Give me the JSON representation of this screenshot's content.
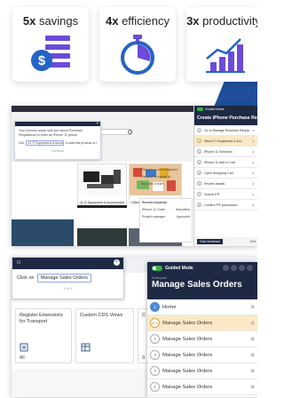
{
  "stats": [
    {
      "value": "5x",
      "label": "savings",
      "icon": "dollar-list-icon"
    },
    {
      "value": "4x",
      "label": "efficiency",
      "icon": "stopwatch-icon"
    },
    {
      "value": "3x",
      "label": "productivity",
      "icon": "bar-chart-trend-icon"
    }
  ],
  "shot1": {
    "popup": {
      "line1": "Your Director spoke with you about Purchase Requisitions to order an iPhone 11 phone.",
      "line2": "Click",
      "chip1": "11 IT Equipment & Accessories",
      "line3": "to add this product to the cart.",
      "next": "Continue"
    },
    "panel": {
      "brand": "Guided Mode",
      "title": "Create iPhone Purchase Req",
      "steps": [
        {
          "n": "1",
          "text": "Go to Manage Purchase Requisitions"
        },
        {
          "n": "2",
          "text": "Select IT Equipment & Acc"
        },
        {
          "n": "3",
          "text": "iPhone 11 Selection"
        },
        {
          "n": "4",
          "text": "iPhone 11 Add to Cart"
        },
        {
          "n": "5",
          "text": "Open Shopping Cart"
        },
        {
          "n": "6",
          "text": "Review details"
        },
        {
          "n": "7",
          "text": "Submit PR"
        },
        {
          "n": "8",
          "text": "Confirm PR submission"
        }
      ],
      "footer_button": "Give feedback",
      "footer_right": "Exit"
    },
    "tiles": [
      {
        "label": "11 IT Equipment & Accessories"
      },
      {
        "label": "Office Supplies"
      }
    ],
    "links": [
      "Request a consulting item",
      "Request on behalf of",
      "Buy with a team"
    ],
    "requests": {
      "title": "Recent requests",
      "items": [
        {
          "name": "iPhone 11 Order",
          "status": "Submitted"
        },
        {
          "name": "Project manager",
          "status": "Approved"
        }
      ]
    }
  },
  "shot2": {
    "popup": {
      "label": "Click on",
      "chip": "Manage Sales Orders",
      "pager": "1 of 8"
    },
    "tiles": [
      {
        "title": "Register Extensions for Transport",
        "footer": "All"
      },
      {
        "title": "Custom CDS Views",
        "footer": ""
      },
      {
        "title": "C",
        "footer": "S"
      }
    ],
    "panel": {
      "brand": "Guided Mode",
      "logo": "Enterpret",
      "title": "Manage Sales Orders",
      "steps": [
        {
          "n": "1",
          "text": "Home"
        },
        {
          "n": "1.1",
          "text": "Manage Sales Orders"
        },
        {
          "n": "2",
          "text": "Manage Sales Orders"
        },
        {
          "n": "3",
          "text": "Manage Sales Orders"
        },
        {
          "n": "4",
          "text": "Manage Sales Orders"
        },
        {
          "n": "5",
          "text": "Manage Sales Orders"
        }
      ]
    }
  },
  "colors": {
    "navy": "#1e2a44",
    "purple": "#6b4bd8",
    "blue": "#2463c7",
    "green": "#36b24a",
    "highlight": "#fbe9c6"
  }
}
